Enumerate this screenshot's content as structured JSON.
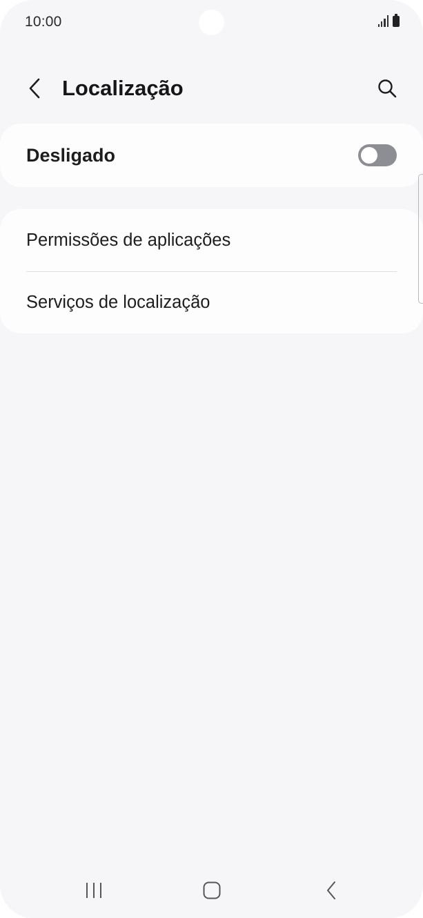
{
  "status_bar": {
    "time": "10:00",
    "icons": [
      "signal-icon",
      "battery-icon"
    ]
  },
  "header": {
    "title": "Localização",
    "back_icon": "chevron-left-icon",
    "search_icon": "search-icon"
  },
  "master_switch": {
    "label": "Desligado",
    "enabled": false
  },
  "menu": {
    "items": [
      {
        "label": "Permissões de aplicações"
      },
      {
        "label": "Serviços de localização"
      }
    ]
  },
  "nav_bar": {
    "buttons": [
      "recents-icon",
      "home-icon",
      "back-icon"
    ]
  },
  "colors": {
    "background": "#f6f6f8",
    "card": "#fdfdfe",
    "toggle_off": "#8d8e93",
    "text": "#1d1d1d"
  }
}
